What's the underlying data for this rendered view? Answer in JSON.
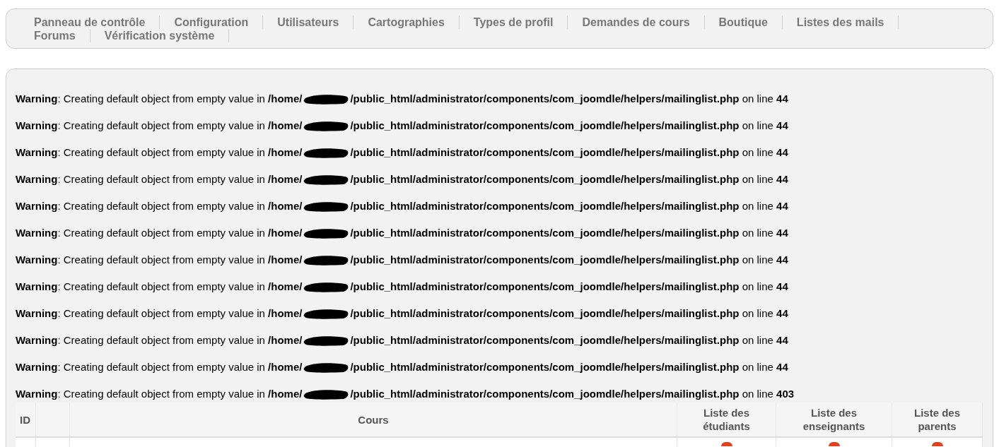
{
  "nav": {
    "items": [
      {
        "label": "Panneau de contrôle"
      },
      {
        "label": "Configuration"
      },
      {
        "label": "Utilisateurs"
      },
      {
        "label": "Cartographies"
      },
      {
        "label": "Types de profil"
      },
      {
        "label": "Demandes de cours"
      },
      {
        "label": "Boutique"
      },
      {
        "label": "Listes des mails"
      },
      {
        "label": "Forums"
      },
      {
        "label": "Vérification système"
      }
    ]
  },
  "warnings": [
    {
      "before": "**Warning**: Creating default object from empty value in **/home/**",
      "after": "**/public_html/administrator/components/com_joomdle/helpers/mailinglist.php** on line **44**"
    },
    {
      "before": "**Warning**: Creating default object from empty value in **/home/**",
      "after": "**/public_html/administrator/components/com_joomdle/helpers/mailinglist.php** on line **44**"
    },
    {
      "before": "**Warning**: Creating default object from empty value in **/home/**",
      "after": "**/public_html/administrator/components/com_joomdle/helpers/mailinglist.php** on line **44**"
    },
    {
      "before": "**Warning**: Creating default object from empty value in **/home/**",
      "after": "**/public_html/administrator/components/com_joomdle/helpers/mailinglist.php** on line **44**"
    },
    {
      "before": "**Warning**: Creating default object from empty value in **/home/**",
      "after": "**/public_html/administrator/components/com_joomdle/helpers/mailinglist.php** on line **44**"
    },
    {
      "before": "**Warning**: Creating default object from empty value in **/home/**",
      "after": "**/public_html/administrator/components/com_joomdle/helpers/mailinglist.php** on line **44**"
    },
    {
      "before": "**Warning**: Creating default object from empty value in **/home/**",
      "after": "**/public_html/administrator/components/com_joomdle/helpers/mailinglist.php** on line **44**"
    },
    {
      "before": "**Warning**: Creating default object from empty value in **/home/**",
      "after": "**/public_html/administrator/components/com_joomdle/helpers/mailinglist.php** on line **44**"
    },
    {
      "before": "**Warning**: Creating default object from empty value in **/home/**",
      "after": "**/public_html/administrator/components/com_joomdle/helpers/mailinglist.php** on line **44**"
    },
    {
      "before": "**Warning**: Creating default object from empty value in **/home/**",
      "after": "**/public_html/administrator/components/com_joomdle/helpers/mailinglist.php** on line **44**"
    },
    {
      "before": "**Warning**: Creating default object from empty value in **/home/**",
      "after": "**/public_html/administrator/components/com_joomdle/helpers/mailinglist.php** on line **44**"
    },
    {
      "before": "**Warning**: Creating default object from empty value in **/home/**",
      "after": "**/public_html/administrator/components/com_joomdle/helpers/mailinglist.php** on line **403**"
    }
  ],
  "table": {
    "columns": [
      {
        "label": "ID"
      },
      {},
      {
        "label": "Cours"
      },
      {
        "label": "Liste des étudiants"
      },
      {
        "label": "Liste des enseignants"
      },
      {
        "label": "Liste des parents"
      }
    ]
  }
}
